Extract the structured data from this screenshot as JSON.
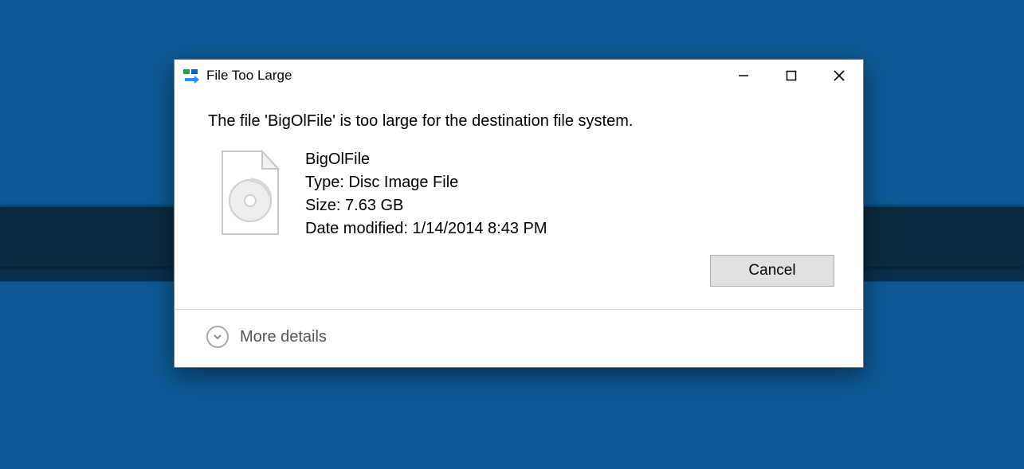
{
  "dialog": {
    "title": "File Too Large",
    "message": "The file 'BigOlFile' is too large for the destination file system.",
    "file": {
      "name": "BigOlFile",
      "type_label": "Type: Disc Image File",
      "size_label": "Size: 7.63 GB",
      "date_label": "Date modified: 1/14/2014 8:43 PM"
    },
    "buttons": {
      "cancel": "Cancel"
    },
    "more_details": "More details"
  }
}
